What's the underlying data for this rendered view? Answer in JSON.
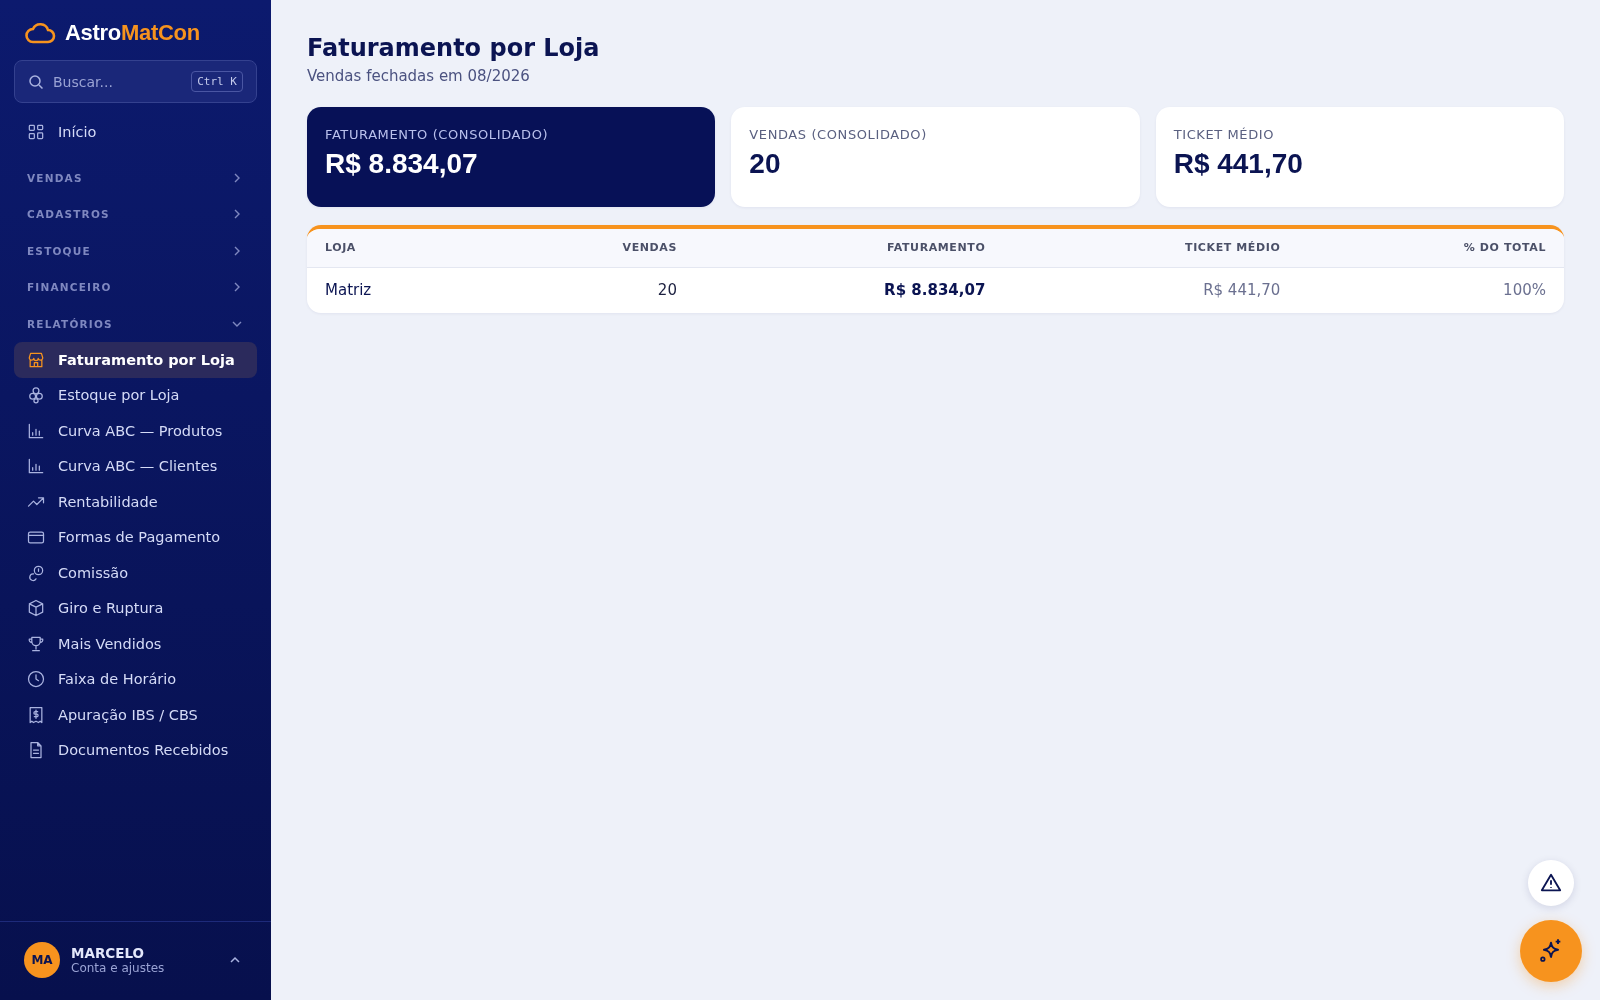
{
  "brand": {
    "part_1": "Astro",
    "part_2": "MatCon"
  },
  "search": {
    "placeholder": "Buscar...",
    "shortcut": "Ctrl K"
  },
  "home": {
    "label": "Início",
    "selected": false
  },
  "sections": [
    {
      "label": "VENDAS",
      "expanded": false
    },
    {
      "label": "CADASTROS",
      "expanded": false
    },
    {
      "label": "ESTOQUE",
      "expanded": false
    },
    {
      "label": "FINANCEIRO",
      "expanded": false
    },
    {
      "label": "RELATÓRIOS",
      "expanded": true,
      "children": [
        {
          "label": "Faturamento por Loja",
          "selected": true
        },
        {
          "label": "Estoque por Loja",
          "selected": false
        },
        {
          "label": "Curva ABC — Produtos",
          "selected": false
        },
        {
          "label": "Curva ABC — Clientes",
          "selected": false
        },
        {
          "label": "Rentabilidade",
          "selected": false
        },
        {
          "label": "Formas de Pagamento",
          "selected": false
        },
        {
          "label": "Comissão",
          "selected": false
        },
        {
          "label": "Giro e Ruptura",
          "selected": false
        },
        {
          "label": "Mais Vendidos",
          "selected": false
        },
        {
          "label": "Faixa de Horário",
          "selected": false
        },
        {
          "label": "Apuração IBS / CBS",
          "selected": false
        },
        {
          "label": "Documentos Recebidos",
          "selected": false
        }
      ]
    }
  ],
  "user": {
    "initials": "MA",
    "name": "MARCELO",
    "subtitle": "Conta e ajustes"
  },
  "page": {
    "title": "Faturamento por Loja",
    "subtitle": "Vendas fechadas em 08/2026"
  },
  "kpis": [
    {
      "label": "FATURAMENTO (CONSOLIDADO)",
      "value": "R$ 8.834,07",
      "emphasized": true
    },
    {
      "label": "VENDAS (CONSOLIDADO)",
      "value": "20",
      "emphasized": false
    },
    {
      "label": "TICKET MÉDIO",
      "value": "R$ 441,70",
      "emphasized": false
    }
  ],
  "table": {
    "columns": [
      "LOJA",
      "VENDAS",
      "FATURAMENTO",
      "TICKET MÉDIO",
      "% DO TOTAL"
    ],
    "rows": [
      [
        "Matriz",
        "20",
        "R$ 8.834,07",
        "R$ 441,70",
        "100%"
      ]
    ]
  }
}
